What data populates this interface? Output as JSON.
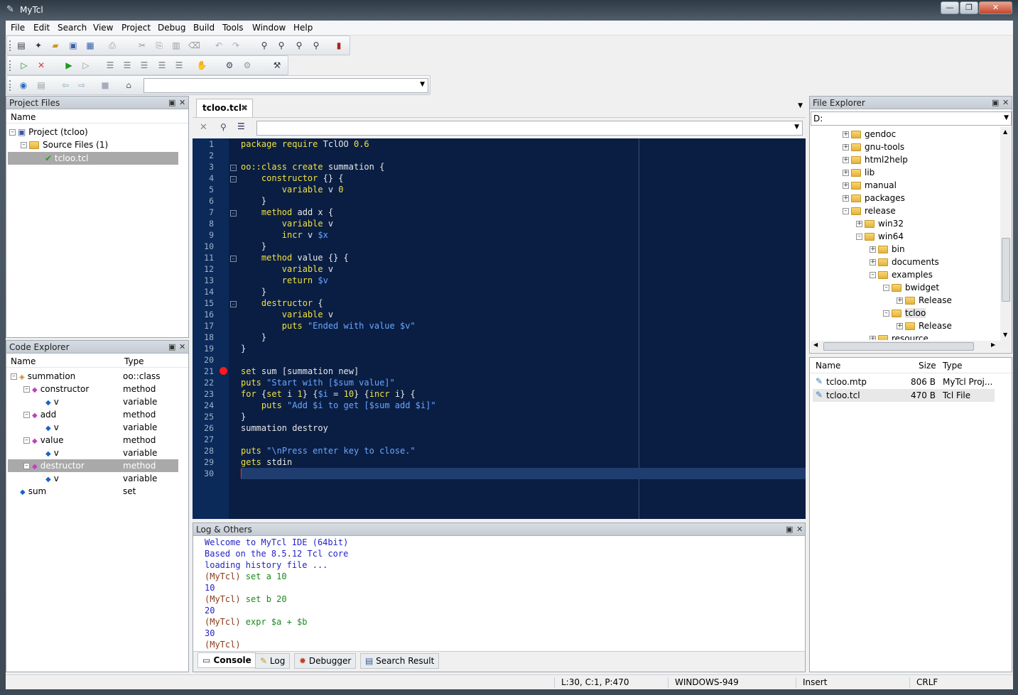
{
  "app": {
    "title": "MyTcl"
  },
  "window_controls": {
    "minimize": "—",
    "maximize": "❐",
    "close": "✕"
  },
  "menu": [
    "File",
    "Edit",
    "Search",
    "View",
    "Project",
    "Debug",
    "Build",
    "Tools",
    "Window",
    "Help"
  ],
  "toolbar": {
    "combo_value": ""
  },
  "project_files": {
    "title": "Project Files",
    "column": "Name",
    "items": [
      {
        "label": "Project (tcloo)"
      },
      {
        "label": "Source Files (1)"
      },
      {
        "label": "tcloo.tcl"
      }
    ]
  },
  "code_explorer": {
    "title": "Code Explorer",
    "columns": [
      "Name",
      "Type"
    ],
    "rows": [
      {
        "name": "summation",
        "type": "oo::class"
      },
      {
        "name": "constructor",
        "type": "method"
      },
      {
        "name": "v",
        "type": "variable"
      },
      {
        "name": "add",
        "type": "method"
      },
      {
        "name": "v",
        "type": "variable"
      },
      {
        "name": "value",
        "type": "method"
      },
      {
        "name": "v",
        "type": "variable"
      },
      {
        "name": "destructor",
        "type": "method"
      },
      {
        "name": "v",
        "type": "variable"
      },
      {
        "name": "sum",
        "type": "set"
      }
    ]
  },
  "editor": {
    "tab": "tcloo.tcl",
    "lines": [
      "package require TclOO 0.6",
      "",
      "oo::class create summation {",
      "    constructor {} {",
      "        variable v 0",
      "    }",
      "    method add x {",
      "        variable v",
      "        incr v $x",
      "    }",
      "    method value {} {",
      "        variable v",
      "        return $v",
      "    }",
      "    destructor {",
      "        variable v",
      "        puts \"Ended with value $v\"",
      "    }",
      "}",
      "",
      "set sum [summation new]",
      "puts \"Start with [$sum value]\"",
      "for {set i 1} {$i = 10} {incr i} {",
      "    puts \"Add $i to get [$sum add $i]\"",
      "}",
      "summation destroy",
      "",
      "puts \"\\nPress enter key to close.\"",
      "gets stdin",
      ""
    ],
    "line_numbers": [
      "1",
      "2",
      "3",
      "4",
      "5",
      "6",
      "7",
      "8",
      "9",
      "10",
      "11",
      "12",
      "13",
      "14",
      "15",
      "16",
      "17",
      "18",
      "19",
      "20",
      "21",
      "22",
      "23",
      "24",
      "25",
      "26",
      "27",
      "28",
      "29",
      "30"
    ]
  },
  "log": {
    "title": "Log & Others",
    "console_lines": [
      {
        "text": "Welcome to MyTcl IDE (64bit)",
        "color": "#2323c8"
      },
      {
        "text": "Based on the 8.5.12 Tcl core",
        "color": "#2323c8"
      },
      {
        "text": "loading history file ...",
        "color": "#2323c8"
      },
      {
        "prompt": "(MyTcl)",
        "text": " set a 10",
        "color": "#1a8a1a"
      },
      {
        "text": "10",
        "color": "#2323c8"
      },
      {
        "prompt": "(MyTcl)",
        "text": " set b 20",
        "color": "#1a8a1a"
      },
      {
        "text": "20",
        "color": "#2323c8"
      },
      {
        "prompt": "(MyTcl)",
        "text": " expr $a + $b",
        "color": "#1a8a1a"
      },
      {
        "text": "30",
        "color": "#2323c8"
      },
      {
        "prompt": "(MyTcl)",
        "text": "",
        "color": "#1a8a1a"
      }
    ],
    "tabs": [
      "Console",
      "Log",
      "Debugger",
      "Search Result"
    ]
  },
  "file_explorer": {
    "title": "File Explorer",
    "drive": "D:",
    "tree": [
      {
        "label": "gendoc",
        "level": 0
      },
      {
        "label": "gnu-tools",
        "level": 0
      },
      {
        "label": "html2help",
        "level": 0
      },
      {
        "label": "lib",
        "level": 0
      },
      {
        "label": "manual",
        "level": 0
      },
      {
        "label": "packages",
        "level": 0
      },
      {
        "label": "release",
        "level": 0
      },
      {
        "label": "win32",
        "level": 1
      },
      {
        "label": "win64",
        "level": 1
      },
      {
        "label": "bin",
        "level": 2
      },
      {
        "label": "documents",
        "level": 2
      },
      {
        "label": "examples",
        "level": 2
      },
      {
        "label": "bwidget",
        "level": 3
      },
      {
        "label": "Release",
        "level": 4
      },
      {
        "label": "tcloo",
        "level": 3
      },
      {
        "label": "Release",
        "level": 4
      },
      {
        "label": "resource",
        "level": 2
      }
    ],
    "columns": [
      "Name",
      "Size",
      "Type"
    ],
    "files": [
      {
        "name": "tcloo.mtp",
        "size": "806 B",
        "type": "MyTcl Proj..."
      },
      {
        "name": "tcloo.tcl",
        "size": "470 B",
        "type": "Tcl File"
      }
    ]
  },
  "status": {
    "position": "L:30, C:1, P:470",
    "encoding": "WINDOWS-949",
    "mode": "Insert",
    "eol": "CRLF"
  }
}
